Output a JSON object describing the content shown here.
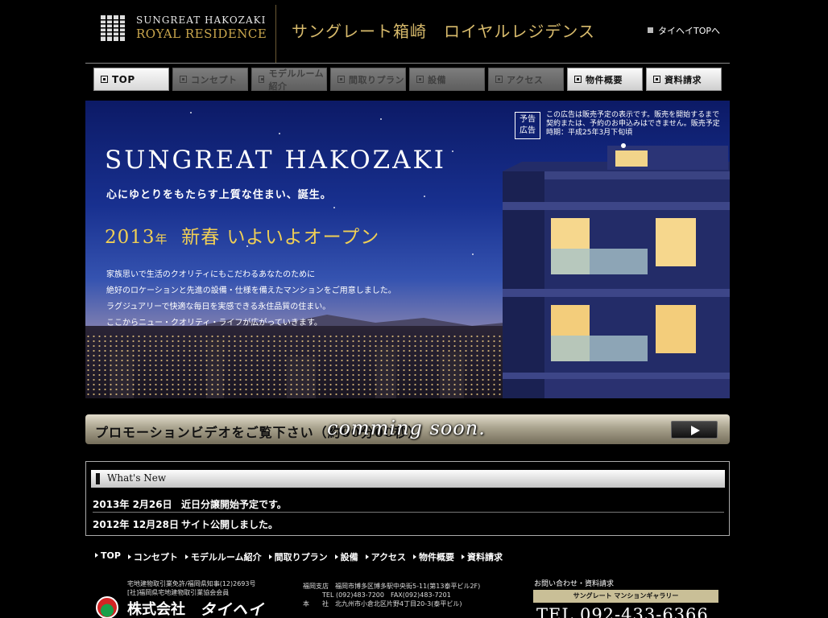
{
  "header": {
    "logo_line1": "SUNGREAT HAKOZAKI",
    "logo_line2": "ROYAL RESIDENCE",
    "site_title": "サングレート箱崎　ロイヤルレジデンス",
    "corp_link": "タイヘイTOPへ"
  },
  "nav": {
    "items": [
      {
        "label": "TOP",
        "state": "active"
      },
      {
        "label": "コンセプト",
        "state": "disabled"
      },
      {
        "label": "モデルルーム紹介",
        "state": "disabled"
      },
      {
        "label": "間取りプラン",
        "state": "disabled"
      },
      {
        "label": "設備",
        "state": "disabled"
      },
      {
        "label": "アクセス",
        "state": "disabled"
      },
      {
        "label": "物件概要",
        "state": "enabled"
      },
      {
        "label": "資料請求",
        "state": "enabled"
      }
    ]
  },
  "hero": {
    "title": "SUNGREAT HAKOZAKI",
    "tagline": "心にゆとりをもたらす上質な住まい、誕生。",
    "open_year": "2013",
    "open_year_unit": "年",
    "open_text": "新春 いよいよオープン",
    "copy": [
      "家族思いで生活のクオリティにもこだわるあなたのために",
      "絶好のロケーションと先進の設備・仕様を備えたマンションをご用意しました。",
      "ラグジュアリーで快適な毎日を実感できる永住品質の住まい。",
      "ここからニュー・クオリティ・ライフが広がっていきます。"
    ],
    "notice_badge_1": "予告",
    "notice_badge_2": "広告",
    "notice_text": "この広告は販売予定の表示です。販売を開始するまで契約または、予約のお申込みはできません。販売予定時期：平成25年3月下旬頃"
  },
  "promo": {
    "text": "プロモーションビデオをご覧下さい（約00分00秒）",
    "overlay": "comming soon."
  },
  "news": {
    "heading": "What's New",
    "items": [
      {
        "date": "2013年 2月26日",
        "text": "近日分譲開始予定です。"
      },
      {
        "date": "2012年 12月28日",
        "text": "サイト公開しました。"
      }
    ]
  },
  "footer_nav": [
    "TOP",
    "コンセプト",
    "モデルルーム紹介",
    "間取りプラン",
    "設備",
    "アクセス",
    "物件概要",
    "資料請求"
  ],
  "footer": {
    "license1": "宅地建物取引業免許/福岡県知事(12)2693号",
    "license2": "[社]福岡県宅地建物取引業協会会員",
    "company": "株式会社",
    "company_logo": "タイヘイ",
    "branch_line1": "福岡支店　福岡市博多区博多駅中央街5-11(第13泰平ビル2F)",
    "branch_line2": "TEL (092)483-7200　FAX(092)483-7201",
    "branch_line3": "本　　社　北九州市小倉北区片野4丁目20-3(泰平ビル)",
    "contact_label": "お問い合わせ・資料請求",
    "gallery": "サングレート マンションギャラリー",
    "tel": "TEL 092-433-6366"
  }
}
